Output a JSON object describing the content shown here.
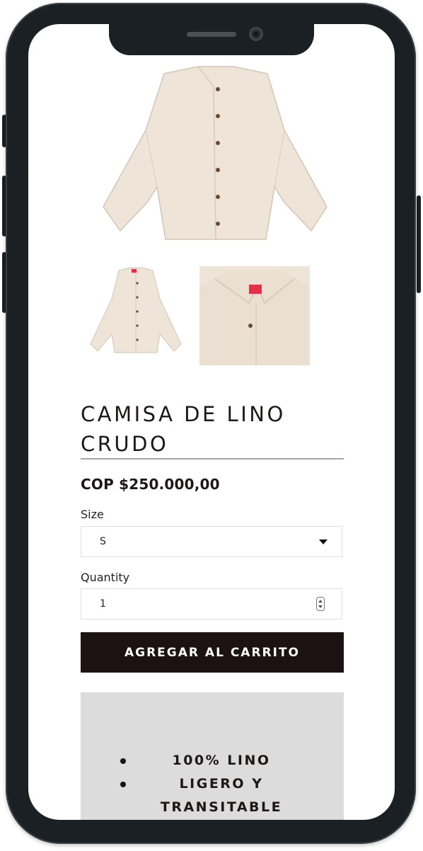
{
  "product": {
    "title": "CAMISA DE LINO CRUDO",
    "price": "COP $250.000,00",
    "gallery_thumbnail_count": 2
  },
  "size": {
    "label": "Size",
    "selected": "S"
  },
  "quantity": {
    "label": "Quantity",
    "value": "1"
  },
  "cart_button": {
    "label": "AGREGAR AL CARRITO"
  },
  "features": [
    "100% LINO",
    "LIGERO Y TRANSITABLE"
  ],
  "colors": {
    "button_bg": "#1c1213",
    "text": "#1f1717",
    "features_bg": "#dcdcdc",
    "shirt": "#efe4d8",
    "label_tag": "#e0304a"
  }
}
